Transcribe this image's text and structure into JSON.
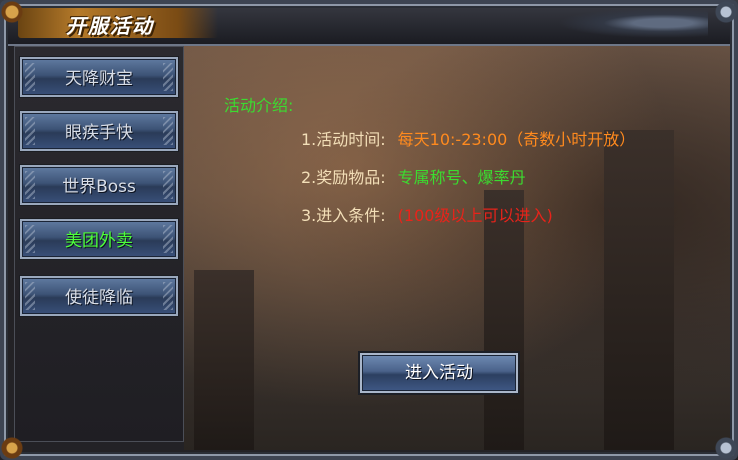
{
  "window": {
    "title": "开服活动"
  },
  "sidebar": {
    "items": [
      {
        "label": "天降财宝",
        "active": false
      },
      {
        "label": "眼疾手快",
        "active": false
      },
      {
        "label": "世界Boss",
        "active": false
      },
      {
        "label": "美团外卖",
        "active": true
      },
      {
        "label": "使徒降临",
        "active": false
      }
    ]
  },
  "activity": {
    "intro_label": "活动介绍:",
    "rows": [
      {
        "key": "1.活动时间:",
        "value": "每天10:-23:00（奇数小时开放）",
        "color": "#ff8a1e"
      },
      {
        "key": "2.奖励物品:",
        "value": "专属称号、爆率丹",
        "color": "#3bdc30"
      },
      {
        "key": "3.进入条件:",
        "value": "(100级以上可以进入)",
        "color": "#e8231a"
      }
    ],
    "enter_button": "进入活动"
  },
  "colors": {
    "active_tab_text": "#4dff3a",
    "title_plate": "#b57a2a"
  }
}
